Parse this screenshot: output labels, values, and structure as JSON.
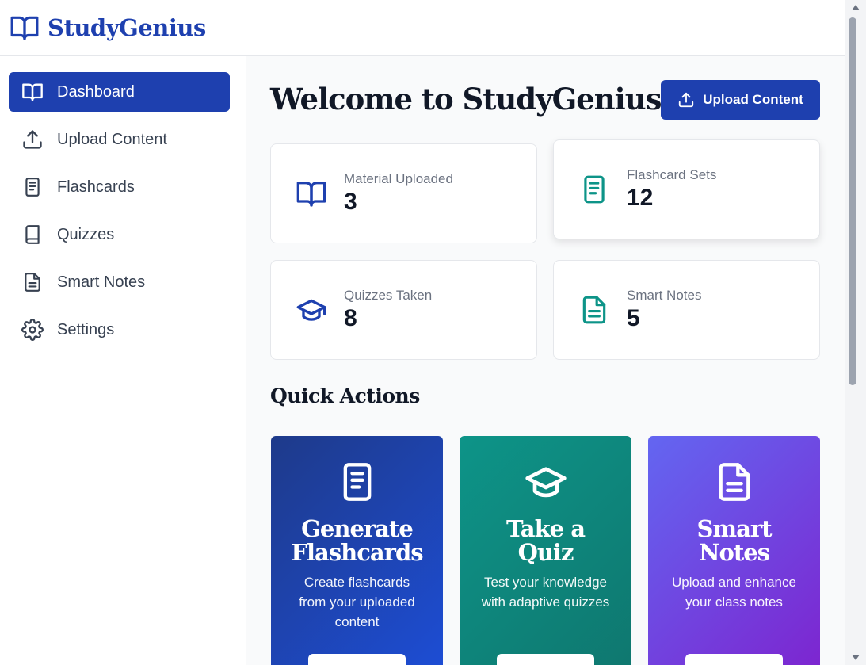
{
  "app": {
    "name": "StudyGenius",
    "logo_icon": "book-open-icon",
    "brand_color": "#1e40af"
  },
  "sidebar": {
    "items": [
      {
        "label": "Dashboard",
        "icon": "book-open-icon",
        "active": true
      },
      {
        "label": "Upload Content",
        "icon": "upload-icon",
        "active": false
      },
      {
        "label": "Flashcards",
        "icon": "document-lines-icon",
        "active": false
      },
      {
        "label": "Quizzes",
        "icon": "book-icon",
        "active": false
      },
      {
        "label": "Smart Notes",
        "icon": "file-text-icon",
        "active": false
      },
      {
        "label": "Settings",
        "icon": "gear-icon",
        "active": false
      }
    ]
  },
  "main": {
    "title": "Welcome to StudyGenius",
    "upload_button": "Upload Content",
    "stats": [
      {
        "label": "Material Uploaded",
        "value": "3",
        "icon": "book-open-icon",
        "color": "#1e40af"
      },
      {
        "label": "Flashcard Sets",
        "value": "12",
        "icon": "document-lines-icon",
        "color": "#0d9488"
      },
      {
        "label": "Quizzes Taken",
        "value": "8",
        "icon": "graduation-cap-icon",
        "color": "#1e40af"
      },
      {
        "label": "Smart Notes",
        "value": "5",
        "icon": "file-text-icon",
        "color": "#0d9488"
      }
    ],
    "quick_actions_title": "Quick Actions",
    "quick_actions": [
      {
        "title_line1": "Generate",
        "title_line2": "Flashcards",
        "description": "Create flashcards from your uploaded content",
        "icon": "document-lines-icon",
        "colors": [
          "#1e3a8a",
          "#1d4ed8"
        ]
      },
      {
        "title_line1": "Take a",
        "title_line2": "Quiz",
        "description": "Test your knowledge with adaptive quizzes",
        "icon": "graduation-cap-icon",
        "colors": [
          "#0d9488",
          "#0f766e"
        ]
      },
      {
        "title_line1": "Smart",
        "title_line2": "Notes",
        "description": "Upload and enhance your class notes",
        "icon": "file-text-icon",
        "colors": [
          "#6366f1",
          "#7e22ce"
        ]
      }
    ]
  }
}
